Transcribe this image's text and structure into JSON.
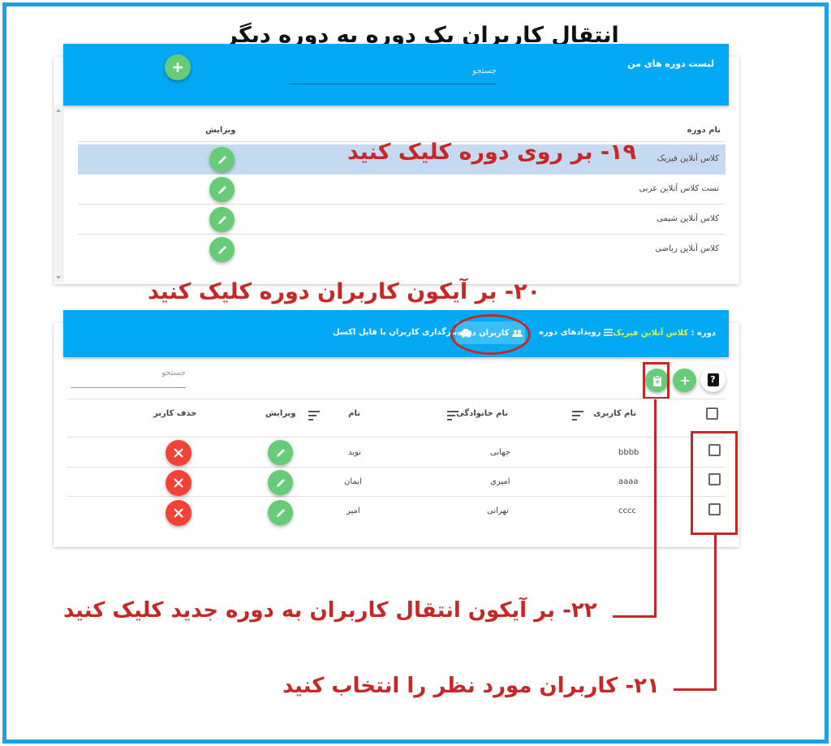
{
  "page_title": "انتقال کاربران یک دوره به دوره دیگر",
  "courses_panel": {
    "header_title": "لیست دوره های من",
    "search_placeholder": "جستجو",
    "col_name": "نام دوره",
    "col_edit": "ویرایش",
    "rows": [
      "کلاس آنلاین فیزیک",
      "تست کلاس آنلاین عربی",
      "کلاس آنلاین شیمی",
      "کلاس آنلاین ریاضی"
    ]
  },
  "users_panel": {
    "course_label": "دوره :",
    "course_name": "کلاس آنلاین فیزیک",
    "tabs": [
      "رویدادهای دوره",
      "کاربران دوره",
      "بارگذاری کاربران با فایل اکسل"
    ],
    "search_placeholder": "جستجو",
    "col_username": "نام کاربری",
    "col_lastname": "نام خانوادگی",
    "col_firstname": "نام",
    "col_edit": "ویرایش",
    "col_delete": "حذف کاربر",
    "rows": [
      {
        "username": "bbbb",
        "lastname": "جهانی",
        "firstname": "نوید"
      },
      {
        "username": "aaaa",
        "lastname": "امیری",
        "firstname": "ایمان"
      },
      {
        "username": "cccc",
        "lastname": "تهرانی",
        "firstname": "امیر"
      }
    ],
    "help_symbol": "?"
  },
  "annotations": {
    "step19": "۱۹- بر روی دوره کلیک کنید",
    "step20": "۲۰- بر آیکون کاربران دوره کلیک کنید",
    "step22": "۲۲- بر آیکون انتقال کاربران به دوره جدید کلیک کنید",
    "step21": "۲۱- کاربران مورد نظر را انتخاب کنید"
  },
  "colors": {
    "accent": "#03a9f4",
    "annotation": "#c62828",
    "add": "#66cc77",
    "delete": "#f44336",
    "selected_row": "#c5d9f1",
    "course_name": "#d7f25a"
  },
  "icons": [
    "plus-icon",
    "pencil-icon",
    "close-icon",
    "users-icon",
    "menu-icon",
    "cloud-upload-icon",
    "clipboard-icon",
    "help-icon",
    "sort-icon"
  ]
}
